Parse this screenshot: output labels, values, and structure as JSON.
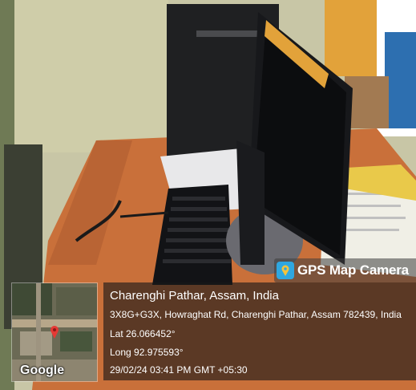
{
  "badge": {
    "app_name": "GPS Map Camera",
    "icon": "map-pin-camera-icon"
  },
  "map_thumbnail": {
    "provider_label": "Google",
    "marker_icon": "map-marker-icon"
  },
  "location": {
    "place": "Charenghi Pathar, Assam, India",
    "address": "3X8G+G3X, Howraghat Rd, Charenghi Pathar, Assam 782439, India",
    "latitude": "Lat 26.066452°",
    "longitude": "Long 92.975593°",
    "timestamp": "29/02/24 03:41 PM GMT +05:30"
  }
}
